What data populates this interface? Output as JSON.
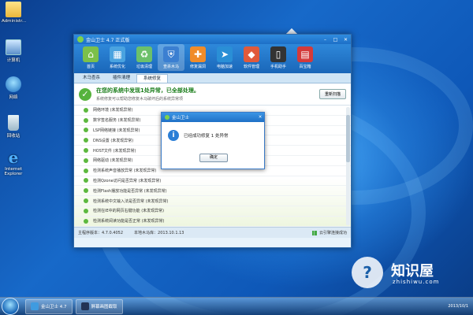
{
  "desktop": {
    "icons": [
      {
        "label": "Administr...",
        "icon": "folder-icon"
      },
      {
        "label": "计算机",
        "icon": "computer-icon"
      },
      {
        "label": "网络",
        "icon": "network-icon"
      },
      {
        "label": "回收站",
        "icon": "recycle-bin-icon"
      },
      {
        "label": "Internet Explorer",
        "icon": "ie-icon"
      }
    ]
  },
  "app": {
    "title": "金山卫士 4.7 正式版",
    "window_controls": [
      "–",
      "□",
      "✕"
    ],
    "toolbar": [
      {
        "label": "首页",
        "icon": "home-icon",
        "color": "#7cc04a"
      },
      {
        "label": "系统优化",
        "icon": "optimize-icon",
        "color": "#4aa3e0"
      },
      {
        "label": "垃圾清理",
        "icon": "trash-icon",
        "color": "#6cc06a"
      },
      {
        "label": "查杀木马",
        "icon": "shield-icon",
        "color": "#3b7fd1"
      },
      {
        "label": "修复漏洞",
        "icon": "bug-icon",
        "color": "#f08c2a"
      },
      {
        "label": "电脑加速",
        "icon": "speed-icon",
        "color": "#2a8fd6"
      },
      {
        "label": "软件管理",
        "icon": "software-icon",
        "color": "#e05a3b"
      },
      {
        "label": "手机助手",
        "icon": "phone-icon",
        "color": "#333333"
      },
      {
        "label": "百宝箱",
        "icon": "toolbox-icon",
        "color": "#d43a3a"
      }
    ],
    "subtabs": [
      "木马查杀",
      "插件清理",
      "系统修复"
    ],
    "active_subtab": 2,
    "status": {
      "headline": "在您的系统中发现1处异常，已全部处理。",
      "sub": "系统修复可以帮助您修复木马破坏后的系统异常项",
      "rescan_label": "重新扫描"
    },
    "items": [
      "网络环境 (未发现异常)",
      "数字签名服务 (未发现异常)",
      "LSP网络链接 (未发现异常)",
      "DNS设置 (未发现异常)",
      "HOST文件 (未发现异常)",
      "网络驱动 (未发现异常)",
      "检测系统声音播放异常 (未发现异常)",
      "检测Qzone访问是否异常 (未发现异常)",
      "检测Flash播放功能是否异常 (未发现异常)",
      "检测系统中文输入法是否异常 (未发现异常)",
      "检测在IE中的网页右键功能 (未发现异常)",
      "检测系统阅读功能是否正常 (未发现异常)"
    ],
    "statusbar": {
      "main_version": "主程序版本：4.7.0.4052",
      "local_lib": "本地木马库：2013.10.1.13",
      "cloud": "云引擎连接成功"
    }
  },
  "dialog": {
    "title": "金山卫士",
    "message": "已经成功修复 1 处异常",
    "ok_label": "确定"
  },
  "taskbar": {
    "tasks": [
      {
        "label": "金山卫士 4.7",
        "icon_color": "#3f9be0"
      },
      {
        "label": "屏幕画图截取",
        "icon_color": "#223355"
      }
    ],
    "clock_time": "",
    "clock_date": "2013/10/1"
  },
  "watermark": {
    "name": "知识屋",
    "url": "zhishiwu.com"
  }
}
